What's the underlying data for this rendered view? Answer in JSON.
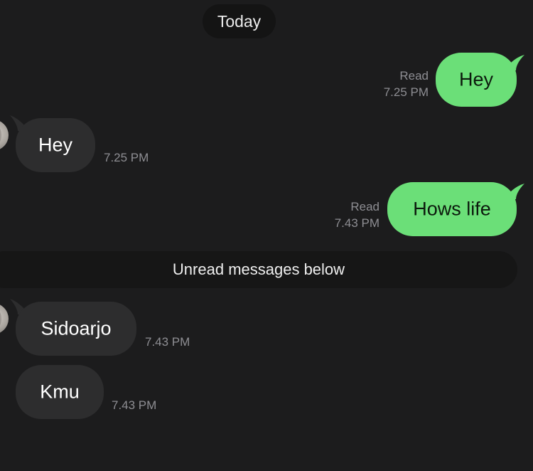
{
  "date_separator": "Today",
  "unread_separator": "Unread messages below",
  "colors": {
    "background": "#1c1c1d",
    "outgoing_bubble": "#6bdf78",
    "incoming_bubble": "#2d2d2e",
    "meta_text": "#8e8e93"
  },
  "messages": [
    {
      "direction": "outgoing",
      "text": "Hey",
      "status": "Read",
      "time": "7.25 PM"
    },
    {
      "direction": "incoming",
      "text": "Hey",
      "time": "7.25 PM"
    },
    {
      "direction": "outgoing",
      "text": "Hows life",
      "status": "Read",
      "time": "7.43 PM"
    },
    {
      "direction": "incoming",
      "text": "Sidoarjo",
      "time": "7.43 PM"
    },
    {
      "direction": "incoming",
      "text": "Kmu",
      "time": "7.43 PM"
    }
  ]
}
